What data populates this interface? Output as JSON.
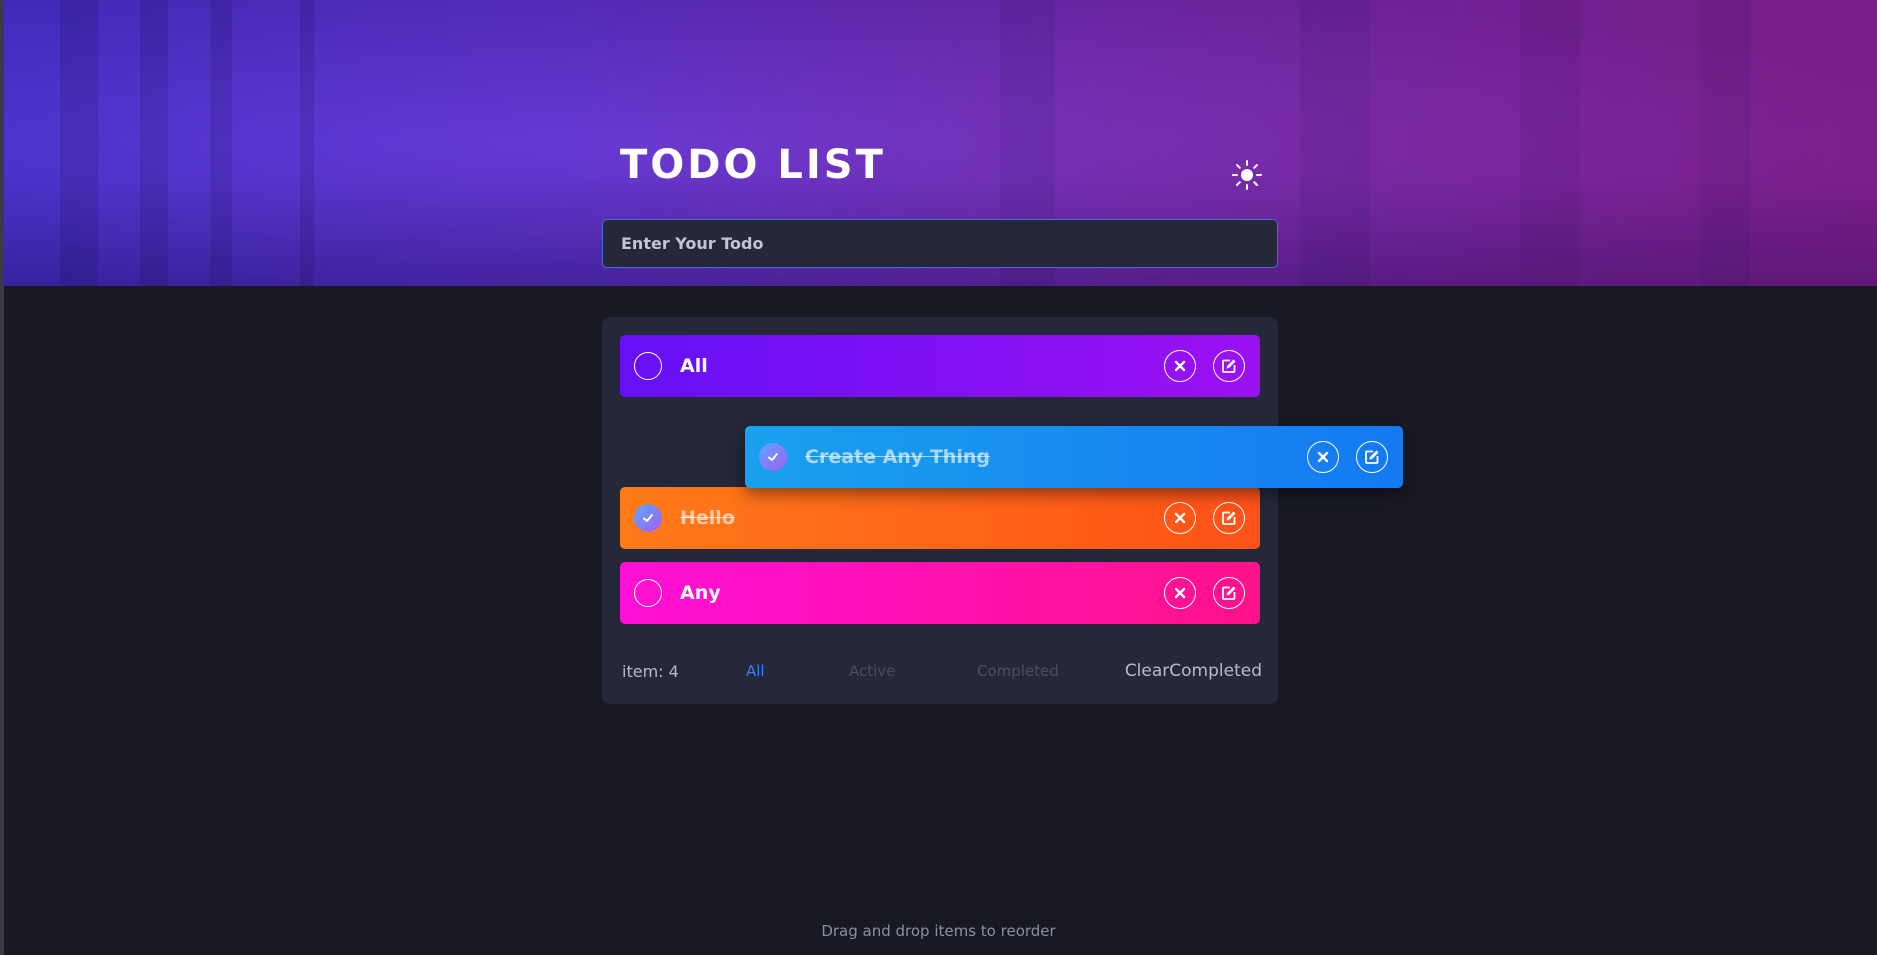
{
  "app": {
    "title": "TODO LIST"
  },
  "input": {
    "placeholder": "Enter Your Todo",
    "value": ""
  },
  "todos": [
    {
      "text": "All",
      "completed": false,
      "color_from": "#6610f5",
      "color_to": "#9c11f2"
    },
    {
      "text": "Create Any Thing",
      "completed": true,
      "dragging": true,
      "color_from": "#1aa0ee",
      "color_to": "#1479f2"
    },
    {
      "text": "Hello",
      "completed": true,
      "color_from": "#ff7a19",
      "color_to": "#ff5218"
    },
    {
      "text": "Any",
      "completed": false,
      "color_from": "#ff10d6",
      "color_to": "#ff1289"
    }
  ],
  "footer": {
    "count": "item: 4",
    "filters": [
      "All",
      "Active",
      "Completed"
    ],
    "active_filter": "All",
    "clear": "ClearCompleted"
  },
  "hint": "Drag and drop items to reorder",
  "icons": {
    "theme": "sun-icon",
    "check": "check-icon",
    "delete": "close-icon",
    "edit": "edit-icon"
  },
  "colors": {
    "background": "#181923",
    "panel": "#242839",
    "accent": "#3a7cff"
  }
}
